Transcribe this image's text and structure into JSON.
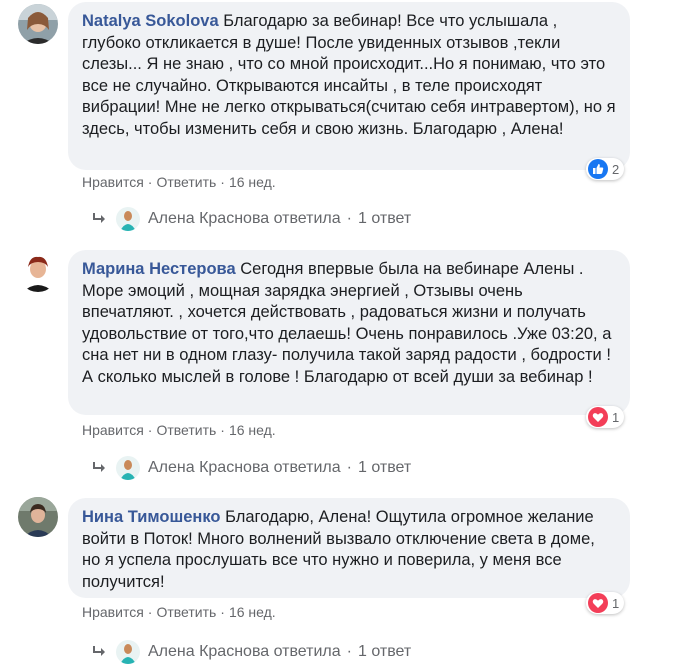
{
  "comments": [
    {
      "author": "Natalya Sokolova",
      "text": "Благодарю за вебинар! Все что услышала , глубоко откликается в душе! После увиденных отзывов ,текли слезы... Я не знаю , что со мной происходит...Но я понимаю, что это все не случайно. Открываются инсайты , в теле происходят вибрации! Мне не легко открываться(считаю себя интравертом), но я здесь, чтобы изменить себя и свою жизнь. Благодарю , Алена!",
      "like_label": "Нравится",
      "reply_label": "Ответить",
      "time": "16 нед.",
      "reaction_type": "like-icon",
      "reaction_count": "2",
      "reply_author": "Алена Краснова ответила",
      "reply_count": "1 ответ"
    },
    {
      "author": "Марина Нестерова",
      "text": "Сегодня впервые была на вебинаре Алены . Море эмоций , мощная зарядка энергией , Отзывы очень впечатляют. , хочется действовать , радоваться жизни и получать удовольствие от того,что делаешь! Очень понравилось .Уже 03:20, а сна нет ни в одном глазу- получила такой заряд радости , бодрости ! А сколько мыслей в голове ! Благодарю от всей души за вебинар !",
      "like_label": "Нравится",
      "reply_label": "Ответить",
      "time": "16 нед.",
      "reaction_type": "heart-icon",
      "reaction_count": "1",
      "reply_author": "Алена Краснова ответила",
      "reply_count": "1 ответ"
    },
    {
      "author": "Нина Тимошенко",
      "text": "Благодарю, Алена! Ощутила огромное желание войти в Поток! Много волнений вызвало отключение света в доме, но я успела прослушать все что нужно и поверила, у меня все получится!",
      "like_label": "Нравится",
      "reply_label": "Ответить",
      "time": "16 нед.",
      "reaction_type": "heart-icon",
      "reaction_count": "1",
      "reply_author": "Алена Краснова ответила",
      "reply_count": "1 ответ"
    }
  ],
  "separator": "·",
  "colors": {
    "author": "#385898",
    "bubble": "#f0f2f5",
    "meta": "#65676b",
    "like": "#1877f2",
    "heart": "#f33e58"
  }
}
